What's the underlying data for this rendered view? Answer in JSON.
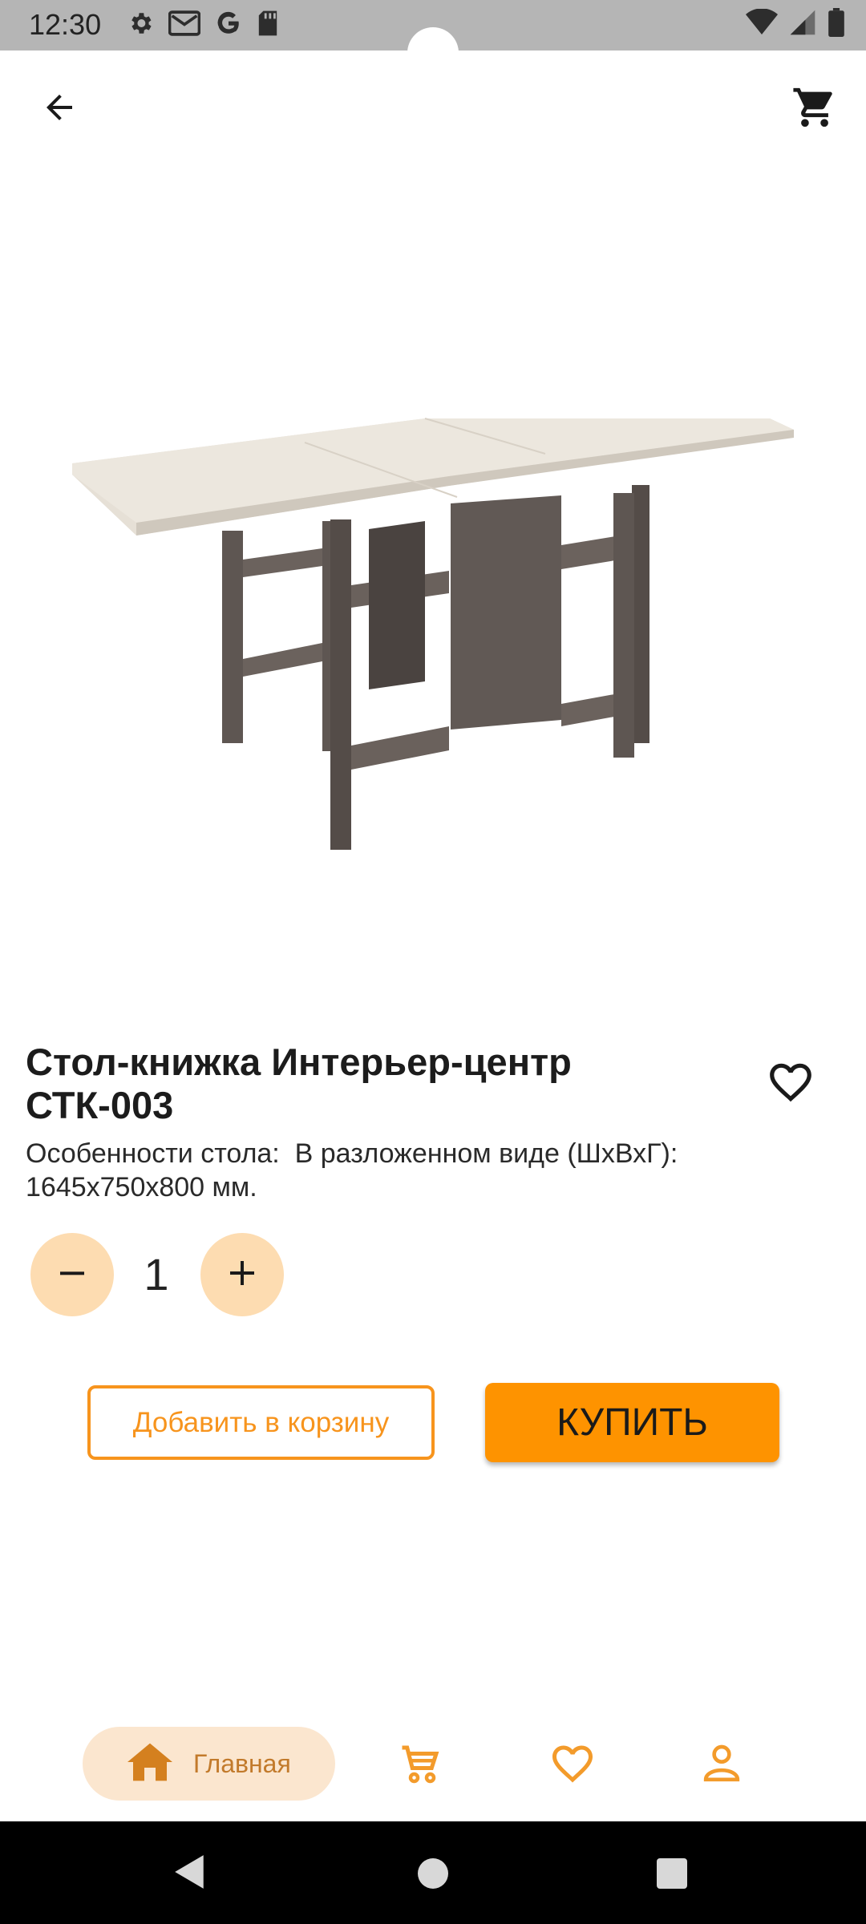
{
  "status_bar": {
    "time": "12:30",
    "left_icons": [
      "settings-icon",
      "gmail-icon",
      "google-icon",
      "sd-card-icon"
    ],
    "right_icons": [
      "wifi-icon",
      "signal-icon",
      "battery-icon"
    ]
  },
  "top_bar": {
    "back_icon": "arrow-left-icon",
    "cart_icon": "cart-icon"
  },
  "product": {
    "image": "folding-table-image",
    "title_line1": "Стол-книжка Интерьер-центр",
    "title_line2": "СТК-003",
    "description_line1": "Особенности стола:  В разложенном виде (ШхВхГ):",
    "description_line2": "1645х750х800 мм.",
    "favorite_icon": "heart-outline-icon"
  },
  "quantity": {
    "value": "1",
    "minus_icon": "minus-icon",
    "plus_icon": "plus-icon"
  },
  "actions": {
    "add_to_cart_label": "Добавить в корзину",
    "buy_label": "КУПИТЬ"
  },
  "bottom_nav": {
    "home_label": "Главная",
    "items": [
      "home-icon",
      "cart-icon",
      "heart-icon",
      "profile-icon"
    ],
    "active": "home",
    "accent_color": "#f7941d",
    "active_bg": "#fbe6cf"
  },
  "colors": {
    "accent": "#fe9300",
    "qty_button_bg": "#fddcb1",
    "status_bar_bg": "#b5b5b5"
  }
}
